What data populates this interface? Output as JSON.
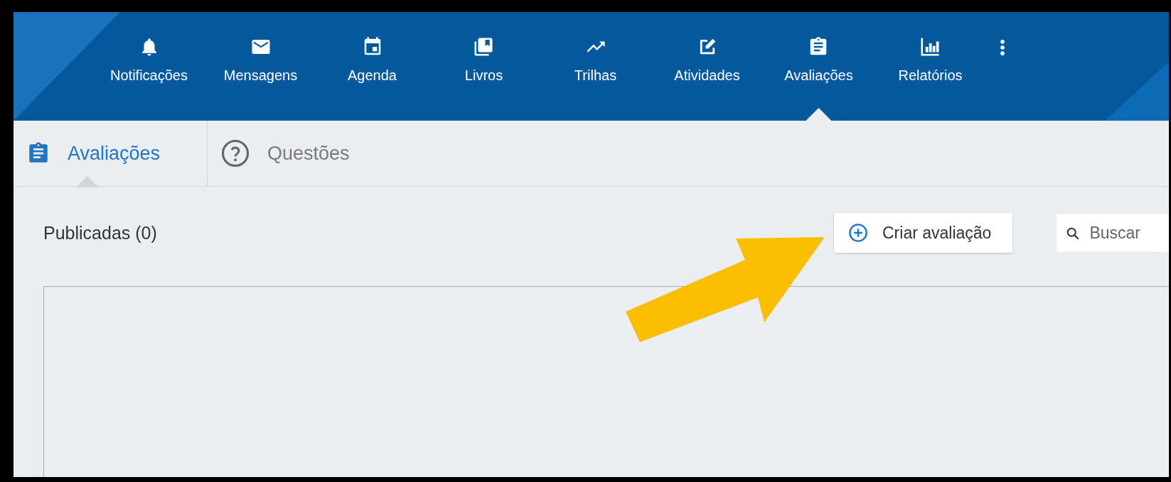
{
  "nav": {
    "items": [
      {
        "label": "Notificações",
        "kind": "bell",
        "selected": false
      },
      {
        "label": "Mensagens",
        "kind": "mail",
        "selected": false
      },
      {
        "label": "Agenda",
        "kind": "calendar",
        "selected": false
      },
      {
        "label": "Livros",
        "kind": "books",
        "selected": false
      },
      {
        "label": "Trilhas",
        "kind": "trend",
        "selected": false
      },
      {
        "label": "Atividades",
        "kind": "edit",
        "selected": false
      },
      {
        "label": "Avaliações",
        "kind": "clipboard",
        "selected": true
      },
      {
        "label": "Relatórios",
        "kind": "chart",
        "selected": false
      }
    ]
  },
  "subtabs": [
    {
      "label": "Avaliações",
      "kind": "clipboard",
      "selected": true
    },
    {
      "label": "Questões",
      "kind": "help",
      "selected": false
    }
  ],
  "content": {
    "heading": "Publicadas (0)",
    "create_button": "Criar avaliação",
    "search": {
      "placeholder": "Buscar"
    }
  }
}
